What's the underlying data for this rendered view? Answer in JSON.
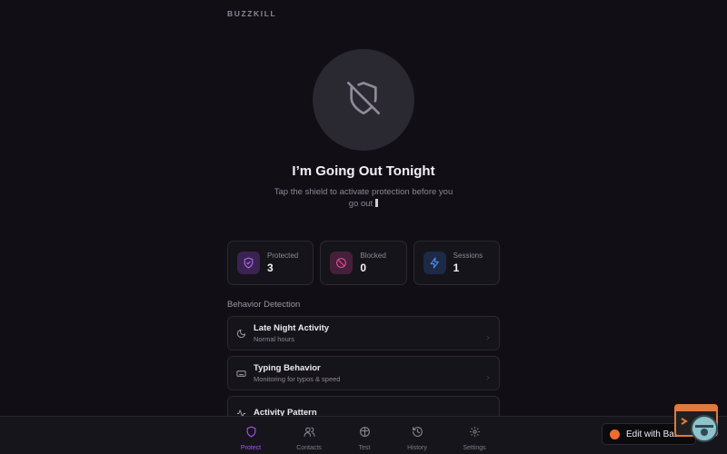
{
  "app": {
    "brand": "BUZZKILL"
  },
  "hero": {
    "title": "I’m Going Out Tonight",
    "subtitle_line1": "Tap the shield to activate protection before you",
    "subtitle_line2": "go out",
    "shield_icon": "shield-off-icon"
  },
  "stats": [
    {
      "label": "Protected",
      "value": "3",
      "icon": "shield-check-icon",
      "color": "#a855f7"
    },
    {
      "label": "Blocked",
      "value": "0",
      "icon": "ban-icon",
      "color": "#ec4899"
    },
    {
      "label": "Sessions",
      "value": "1",
      "icon": "lightning-icon",
      "color": "#3b82f6"
    }
  ],
  "behavior": {
    "heading": "Behavior Detection",
    "items": [
      {
        "name": "Late Night Activity",
        "desc": "Normal hours",
        "icon": "moon-icon"
      },
      {
        "name": "Typing Behavior",
        "desc": "Monitoring for typos & speed",
        "icon": "keyboard-icon"
      },
      {
        "name": "Activity Pattern",
        "desc": "",
        "icon": "activity-icon"
      }
    ]
  },
  "nav": {
    "items": [
      {
        "label": "Protect",
        "icon": "shield-icon",
        "active": true
      },
      {
        "label": "Contacts",
        "icon": "users-icon",
        "active": false
      },
      {
        "label": "Test",
        "icon": "flask-icon",
        "active": false
      },
      {
        "label": "History",
        "icon": "history-icon",
        "active": false
      },
      {
        "label": "Settings",
        "icon": "gear-icon",
        "active": false
      }
    ],
    "accent": "#a855f7"
  },
  "badge": {
    "label": "Edit with Base44"
  }
}
